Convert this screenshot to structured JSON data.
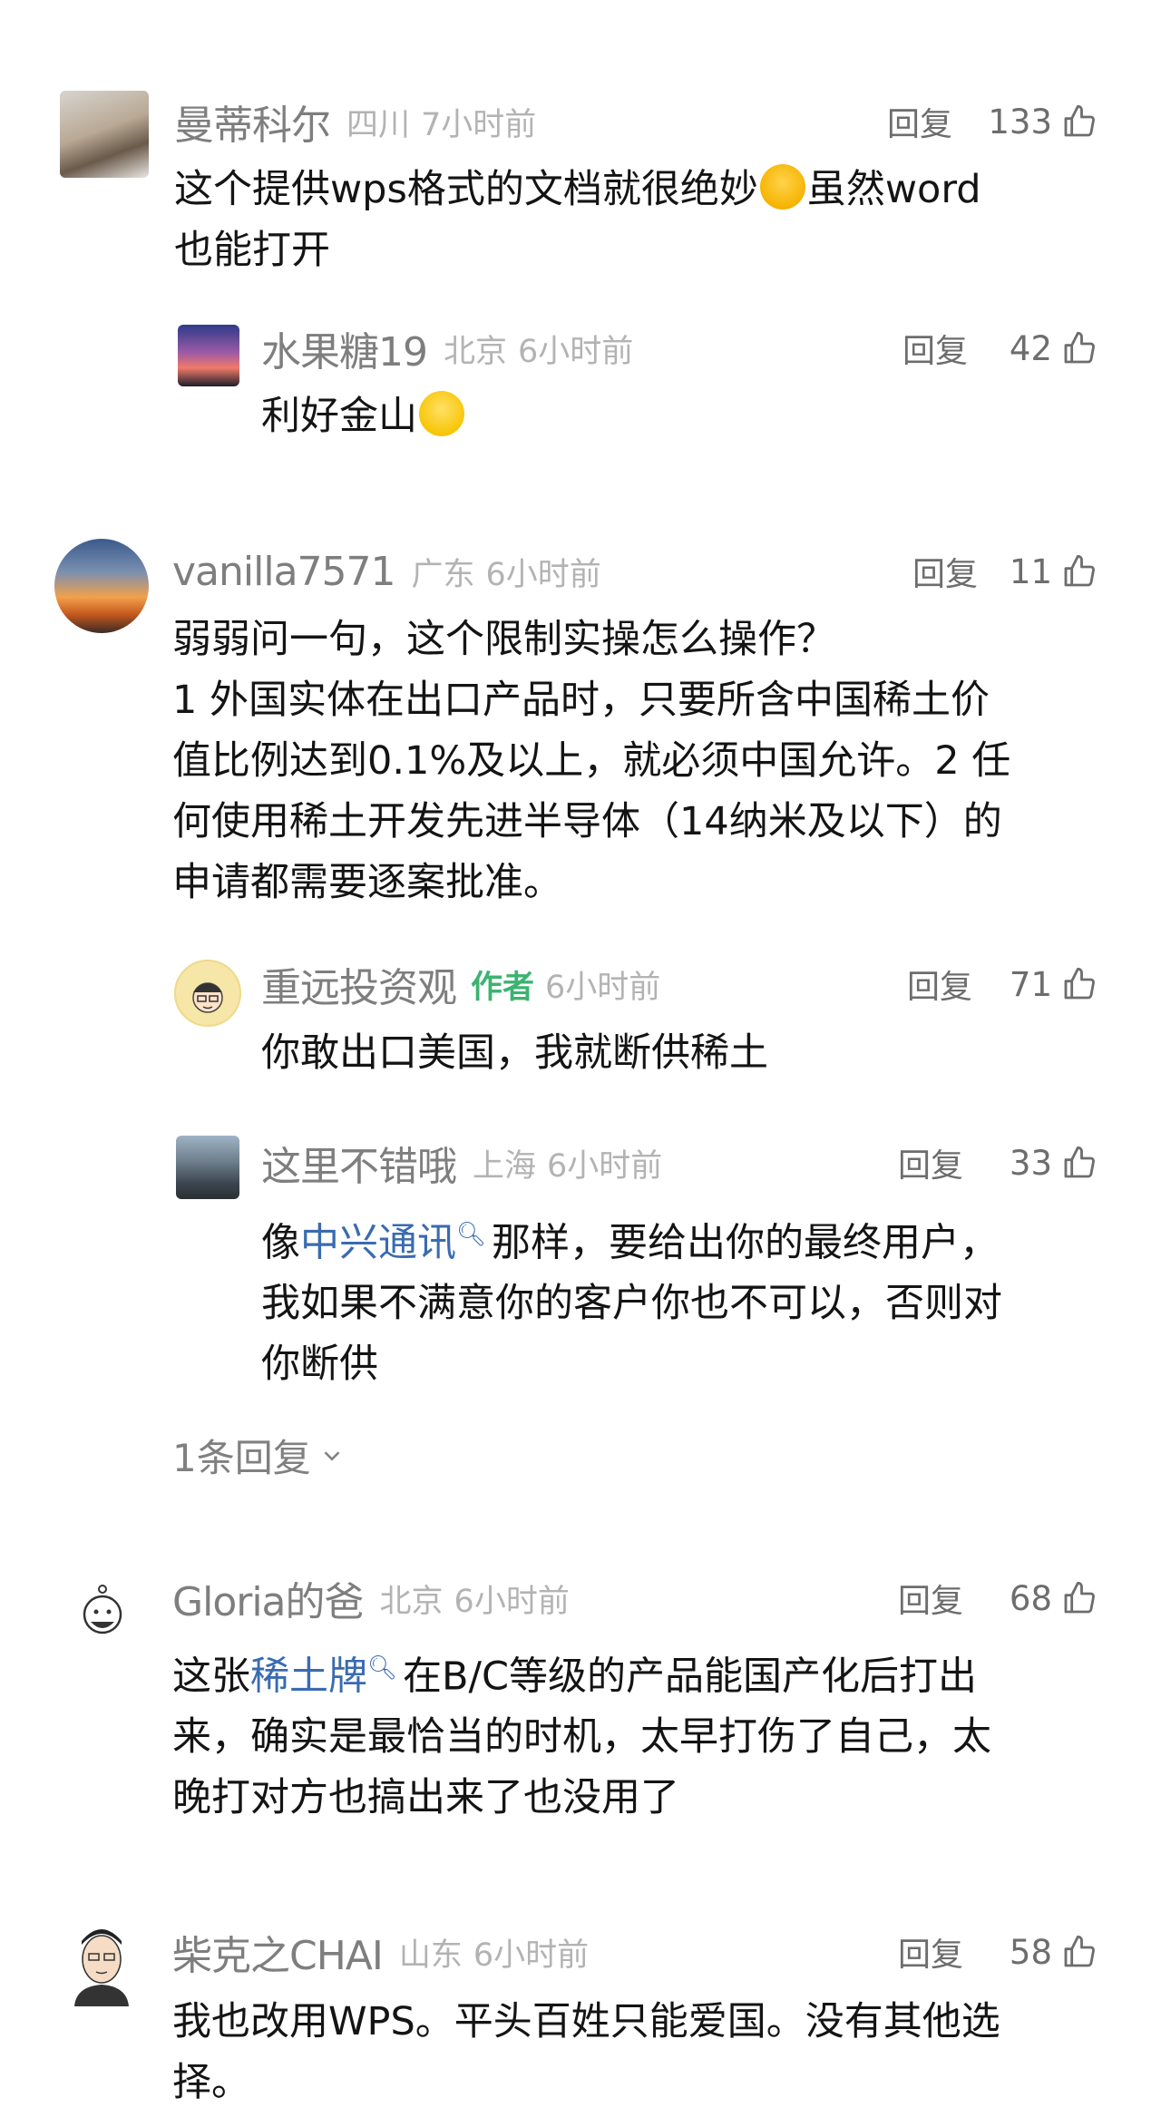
{
  "comments": [
    {
      "user": "曼蒂科尔",
      "location": "四川",
      "time": "7小时前",
      "reply_label": "回复",
      "likes": "133",
      "text_a": "这个提供wps格式的文档就很绝妙",
      "text_b": "虽然word",
      "text_c": "也能打开",
      "emoji": "laughing-crying-emoji",
      "replies": [
        {
          "user": "水果糖19",
          "location": "北京",
          "time": "6小时前",
          "reply_label": "回复",
          "likes": "42",
          "text": "利好金山",
          "emoji": "grinning-emoji"
        }
      ]
    },
    {
      "user": "vanilla7571",
      "location": "广东",
      "time": "6小时前",
      "reply_label": "回复",
      "likes": "11",
      "lines": [
        "弱弱问一句，这个限制实操怎么操作？",
        "1  外国实体在出口产品时，只要所含中国稀土价",
        "值比例达到0.1%及以上，就必须中国允许。2  任",
        "何使用稀土开发先进半导体（14纳米及以下）的",
        "申请都需要逐案批准。"
      ],
      "replies": [
        {
          "user": "重远投资观",
          "author_badge": "作者",
          "time": "6小时前",
          "reply_label": "回复",
          "likes": "71",
          "text": "你敢出口美国，我就断供稀土"
        },
        {
          "user": "这里不错哦",
          "location": "上海",
          "time": "6小时前",
          "reply_label": "回复",
          "likes": "33",
          "line1_prefix": "像",
          "line1_link": "中兴通讯",
          "line1_suffix": "那样，要给出你的最终用户，",
          "line2": "我如果不满意你的客户你也不可以，否则对",
          "line3": "你断供"
        }
      ],
      "more_replies": "1条回复"
    },
    {
      "user": "Gloria的爸",
      "location": "北京",
      "time": "6小时前",
      "reply_label": "回复",
      "likes": "68",
      "line1_prefix": "这张",
      "line1_link": "稀土牌",
      "line1_suffix": "在B/C等级的产品能国产化后打出",
      "line2": "来，确实是最恰当的时机，太早打伤了自己，太",
      "line3": "晚打对方也搞出来了也没用了"
    },
    {
      "user": "柴克之CHAI",
      "location": "山东",
      "time": "6小时前",
      "reply_label": "回复",
      "likes": "58",
      "line1": "我也改用WPS。平头百姓只能爱国。没有其他选",
      "line2": "择。"
    }
  ],
  "colors": {
    "link": "#3a6bb0",
    "author_badge": "#3cb371",
    "meta": "#b3b3b3"
  }
}
